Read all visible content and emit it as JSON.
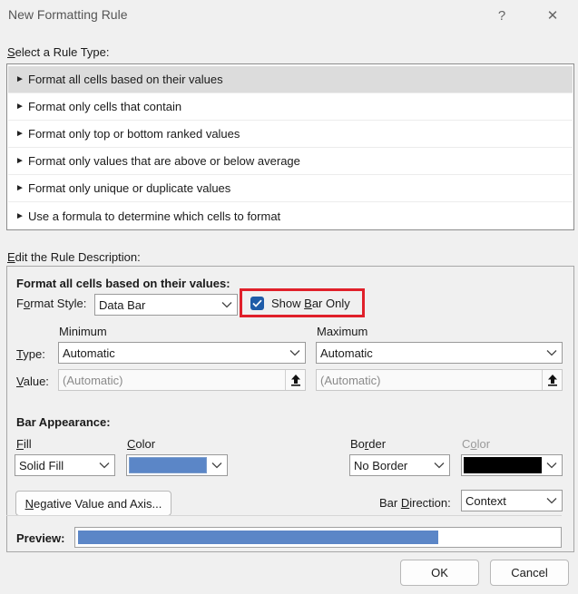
{
  "window": {
    "title": "New Formatting Rule",
    "help_glyph": "?",
    "close_glyph": "✕"
  },
  "rule_type": {
    "heading": "Select a Rule Type:",
    "selected_index": 0,
    "items": [
      {
        "label": "Format all cells based on their values"
      },
      {
        "label": "Format only cells that contain"
      },
      {
        "label": "Format only top or bottom ranked values"
      },
      {
        "label": "Format only values that are above or below average"
      },
      {
        "label": "Format only unique or duplicate values"
      },
      {
        "label": "Use a formula to determine which cells to format"
      }
    ]
  },
  "description": {
    "heading": "Edit the Rule Description:",
    "group_title": "Format all cells based on their values:",
    "format_style_label": "Format Style:",
    "format_style_value": "Data Bar",
    "show_bar_only_label": "Show Bar Only",
    "show_bar_only_checked": true,
    "minimum_header": "Minimum",
    "maximum_header": "Maximum",
    "type_label": "Type:",
    "value_label": "Value:",
    "min_type": "Automatic",
    "max_type": "Automatic",
    "min_value_placeholder": "(Automatic)",
    "max_value_placeholder": "(Automatic)"
  },
  "appearance": {
    "heading": "Bar Appearance:",
    "fill_label": "Fill",
    "fill_value": "Solid Fill",
    "color_label": "Color",
    "fill_color": "#5b86c7",
    "border_label": "Border",
    "border_value": "No Border",
    "border_color_label": "Color",
    "border_color": "#000000",
    "negative_button": "Negative Value and Axis...",
    "direction_label": "Bar Direction:",
    "direction_value": "Context"
  },
  "preview": {
    "label": "Preview:",
    "fill_fraction": 0.75,
    "bar_color": "#5b86c7"
  },
  "buttons": {
    "ok": "OK",
    "cancel": "Cancel"
  }
}
